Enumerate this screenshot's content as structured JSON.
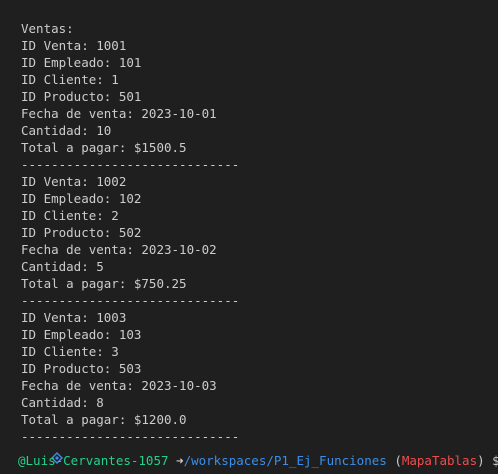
{
  "terminal": {
    "lines": [
      "-----------------------------",
      "",
      "Ventas:",
      "ID Venta: 1001",
      "ID Empleado: 101",
      "ID Cliente: 1",
      "ID Producto: 501",
      "Fecha de venta: 2023-10-01",
      "Cantidad: 10",
      "Total a pagar: $1500.5",
      "-----------------------------",
      "ID Venta: 1002",
      "ID Empleado: 102",
      "ID Cliente: 2",
      "ID Producto: 502",
      "Fecha de venta: 2023-10-02",
      "Cantidad: 5",
      "Total a pagar: $750.25",
      "-----------------------------",
      "ID Venta: 1003",
      "ID Empleado: 103",
      "ID Cliente: 3",
      "ID Producto: 503",
      "Fecha de venta: 2023-10-03",
      "Cantidad: 8",
      "Total a pagar: $1200.0",
      "-----------------------------"
    ],
    "prompt": {
      "icon": "codespaces-icon",
      "user": "@Luis-Cervantes-1057",
      "arrow": "➜",
      "path": "/workspaces/P1_Ej_Funciones",
      "paren_open": "(",
      "branch": "MapaTablas",
      "paren_close": ")",
      "dollar": "$"
    },
    "colors": {
      "background": "#1f1f1f",
      "text": "#cccccc",
      "user": "#23d18b",
      "path": "#3b8eea",
      "branch": "#f14c4c"
    }
  }
}
